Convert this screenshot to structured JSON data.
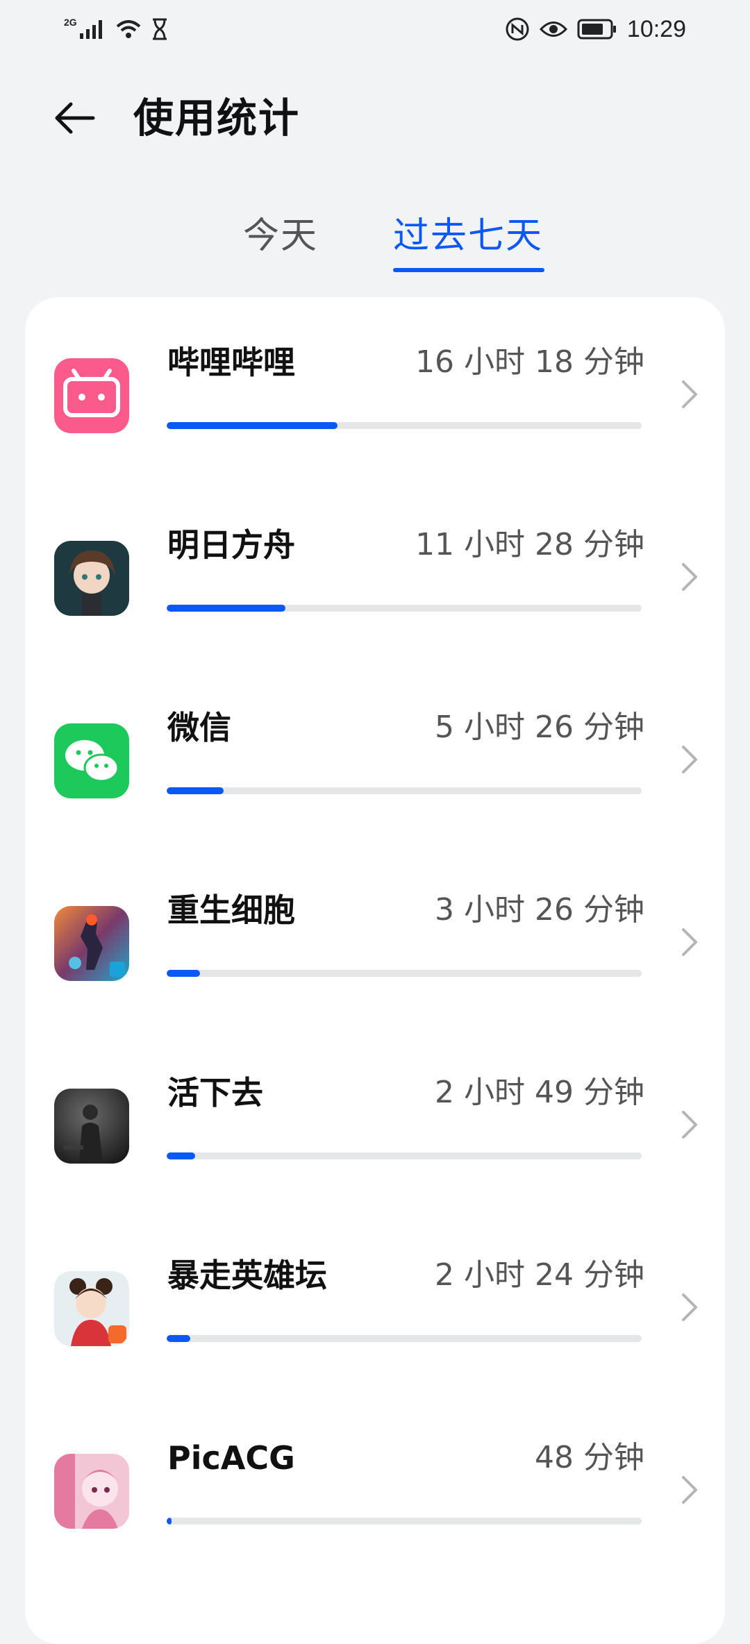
{
  "status_bar": {
    "network_label": "2G",
    "time": "10:29",
    "icons": [
      "signal-icon",
      "wifi-icon",
      "hourglass-icon",
      "nfc-icon",
      "eye-comfort-icon",
      "battery-icon"
    ]
  },
  "header": {
    "title": "使用统计",
    "back_icon": "arrow-left-icon"
  },
  "tabs": [
    {
      "label": "今天",
      "active": false
    },
    {
      "label": "过去七天",
      "active": true
    }
  ],
  "colors": {
    "accent": "#0a59f7",
    "track": "#e5e6e8",
    "background": "#f1f3f5",
    "card": "#ffffff"
  },
  "apps": [
    {
      "name": "哔哩哔哩",
      "time": "16 小时 18 分钟",
      "minutes": 978,
      "icon": "bilibili-icon"
    },
    {
      "name": "明日方舟",
      "time": "11 小时 28 分钟",
      "minutes": 688,
      "icon": "arknights-icon"
    },
    {
      "name": "微信",
      "time": "5 小时 26 分钟",
      "minutes": 326,
      "icon": "wechat-icon"
    },
    {
      "name": "重生细胞",
      "time": "3 小时 26 分钟",
      "minutes": 206,
      "icon": "dead-cells-icon"
    },
    {
      "name": "活下去",
      "time": "2 小时 49 分钟",
      "minutes": 169,
      "icon": "live-or-die-icon"
    },
    {
      "name": "暴走英雄坛",
      "time": "2 小时 24 分钟",
      "minutes": 144,
      "icon": "baozou-yingxiongtan-icon"
    },
    {
      "name": "PicACG",
      "time": "48 分钟",
      "minutes": 48,
      "icon": "picacg-icon"
    }
  ],
  "usage_fraction": [
    0.36,
    0.25,
    0.12,
    0.07,
    0.06,
    0.05,
    0.01
  ]
}
